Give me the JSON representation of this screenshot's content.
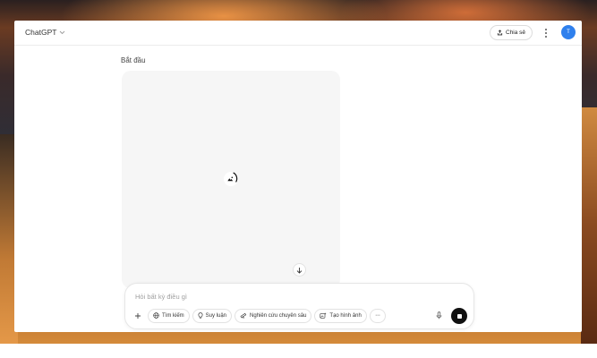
{
  "header": {
    "app_title": "ChatGPT",
    "share_label": "Chia sẻ",
    "avatar_initial": "T"
  },
  "conversation": {
    "title": "Bắt đầu",
    "image_status": "loading"
  },
  "composer": {
    "placeholder": "Hỏi bất kỳ điều gì",
    "value": "",
    "tools": [
      {
        "label": "Tìm kiếm",
        "icon": "globe-icon"
      },
      {
        "label": "Suy luận",
        "icon": "lightbulb-icon"
      },
      {
        "label": "Nghiên cứu chuyên sâu",
        "icon": "telescope-icon"
      },
      {
        "label": "Tạo hình ảnh",
        "icon": "image-sparkle-icon"
      }
    ],
    "more_label": "···"
  },
  "colors": {
    "accent_avatar": "#2f80ed",
    "stop_button": "#111111",
    "placeholder_bg": "#f6f6f6"
  }
}
